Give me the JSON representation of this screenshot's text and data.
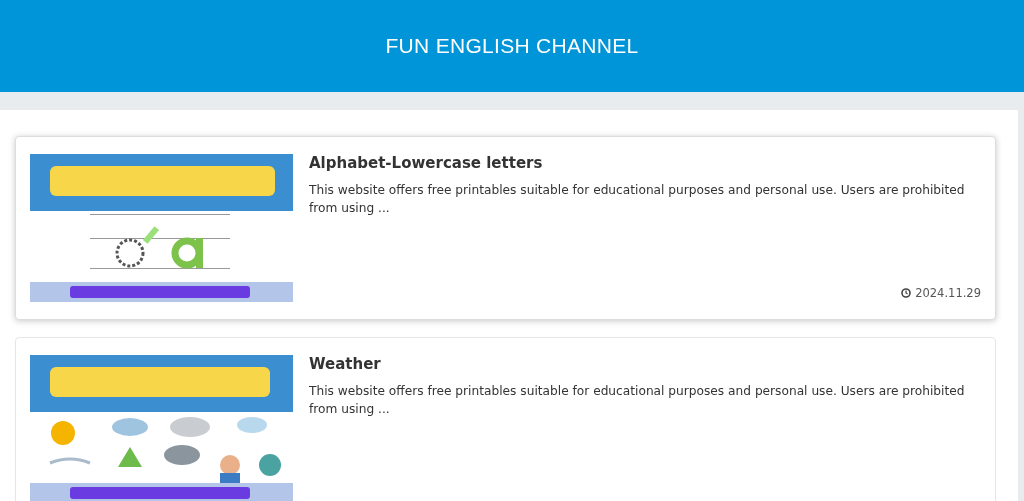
{
  "header": {
    "title": "FUN ENGLISH CHANNEL"
  },
  "posts": [
    {
      "title": "Alphabet-Lowercase letters",
      "excerpt": "This website offers free printables suitable for educational purposes and personal use. Users are prohibited from using ...",
      "date": "2024.11.29",
      "hovered": true
    },
    {
      "title": "Weather",
      "excerpt": "This website offers free printables suitable for educational purposes and personal use. Users are prohibited from using ...",
      "hovered": false
    }
  ]
}
